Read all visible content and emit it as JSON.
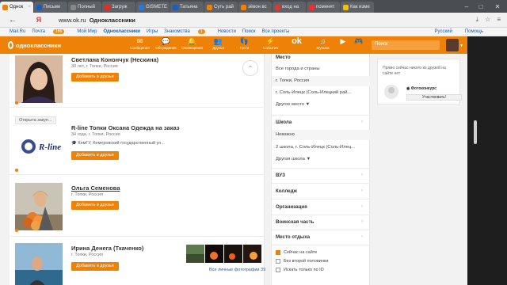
{
  "browser": {
    "tabs": [
      {
        "label": "Однок",
        "color": "#ee8208",
        "active": true
      },
      {
        "label": "Письме",
        "color": "#1a5fb4"
      },
      {
        "label": "Полный",
        "color": "#888888"
      },
      {
        "label": "Загруж",
        "color": "#e52d27"
      },
      {
        "label": "GISMETE",
        "color": "#2a7bd8"
      },
      {
        "label": "Татьяна",
        "color": "#1a5fb4"
      },
      {
        "label": "Суть рай",
        "color": "#ee8208"
      },
      {
        "label": "зёвон вс",
        "color": "#ee8208"
      },
      {
        "label": "вход на",
        "color": "#e33333"
      },
      {
        "label": "поменят",
        "color": "#e33333"
      },
      {
        "label": "Как изме",
        "color": "#f2c200"
      }
    ],
    "yandex_glyph": "Я",
    "url_domain": "www.ok.ru",
    "url_title": "Одноклассники"
  },
  "toplinks": {
    "items": [
      "Mail.Ru",
      "Почта",
      "Мой Мир",
      "Одноклассники",
      "Игры",
      "Знакомства",
      "Новости",
      "Поиск",
      "Все проекты"
    ],
    "mail_badge": "186",
    "znakomstva_badge": "1",
    "language": "Русский",
    "help": "Помощь"
  },
  "ok_header": {
    "logo_text": "одноклассники",
    "nav": [
      {
        "label": "Сообщения",
        "icon": "messages-icon"
      },
      {
        "label": "Обсуждения",
        "icon": "discussions-icon"
      },
      {
        "label": "Оповещения",
        "icon": "notifications-icon"
      },
      {
        "label": "Друзья",
        "icon": "friends-icon"
      },
      {
        "label": "Гости",
        "icon": "guests-icon"
      },
      {
        "label": "События",
        "icon": "events-icon"
      },
      {
        "label": "ok",
        "icon": "ok-icon"
      },
      {
        "label": "Музыка",
        "icon": "music-icon"
      },
      {
        "label": "",
        "icon": "video-icon"
      },
      {
        "label": "",
        "icon": "games-icon"
      }
    ],
    "search_placeholder": "Поиск"
  },
  "people": [
    {
      "name": "Светлана Конончук (Нескина)",
      "info": "30 лет, г. Топки, Россия",
      "add_button": "Добавить в друзья"
    },
    {
      "open_badge": "Открыта закуп...",
      "name": "R-line Топки Оксана Одежда на заказ",
      "info": "34 года, г. Топки, Россия",
      "info2": "КемГУ, Кемеровский государственный ун...",
      "logo_text": "R-line",
      "add_button": "Добавить в друзья"
    },
    {
      "name": "Ольга Семенова",
      "info": "г. Топки, Россия",
      "add_button": "Добавить в друзья"
    },
    {
      "name": "Ирина Денега (Ткаченко)",
      "info": "г. Топки, Россия",
      "add_button": "Добавить в друзья",
      "all_photos": "Все личные фотографии 39"
    }
  ],
  "filters": {
    "place_title": "Место",
    "place_items": [
      "Все города и страны",
      "г. Топки, Россия",
      "г. Соль-Илецк (Соль-Илецкий рай...",
      "Другое место ▼"
    ],
    "school_title": "Школа",
    "school_items": [
      "Неважно",
      "2 школа, г. Соль-Илецк (Соль-Илец...",
      "Другая школа ▼"
    ],
    "sections": [
      "ВУЗ",
      "Колледж",
      "Организация",
      "Воинская часть",
      "Место отдыха"
    ],
    "checkboxes": [
      {
        "label": "Сейчас на сайте",
        "checked": true
      },
      {
        "label": "Без второй половинки",
        "checked": false
      },
      {
        "label": "Искать только по ID",
        "checked": false
      }
    ]
  },
  "right_panel": {
    "text": "Прямо сейчас никого из друзей на сайте нет",
    "contest_title": "Фотоконкурс",
    "participate_button": "Участвовать!"
  },
  "colors": {
    "accent": "#ee8208",
    "link": "#1a5fb4"
  }
}
